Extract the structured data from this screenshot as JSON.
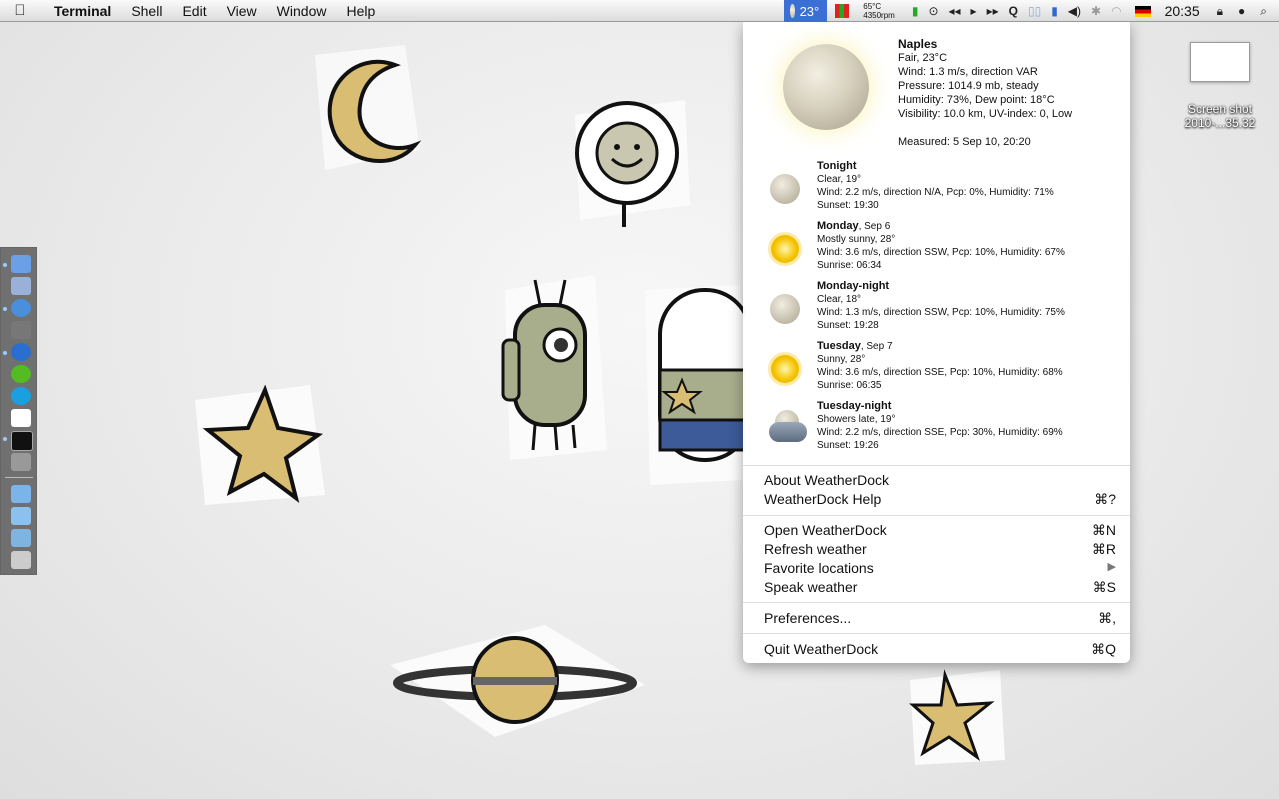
{
  "menubar": {
    "app": "Terminal",
    "menus": [
      "Shell",
      "Edit",
      "View",
      "Window",
      "Help"
    ],
    "weather_temp": "23°",
    "cpu_temp": "65°C",
    "fan": "4350rpm",
    "clock": "20:35"
  },
  "desktop": {
    "icon_label_1": "Screen shot",
    "icon_label_2": "2010-...35.32"
  },
  "current": {
    "city": "Naples",
    "lines": [
      "Fair, 23°C",
      "Wind: 1.3 m/s, direction VAR",
      "Pressure: 1014.9 mb, steady",
      "Humidity: 73%, Dew point: 18°C",
      "Visibility: 10.0 km, UV-index: 0, Low"
    ],
    "measured": "Measured: 5 Sep 10, 20:20"
  },
  "forecast": [
    {
      "day": "Tonight",
      "date": "",
      "cond": "Clear, 19°",
      "wind": "Wind: 2.2 m/s, direction N/A, Pcp: 0%, Humidity: 71%",
      "sun": "Sunset: 19:30",
      "icon": "moon"
    },
    {
      "day": "Monday",
      "date": ", Sep 6",
      "cond": "Mostly sunny, 28°",
      "wind": "Wind: 3.6 m/s, direction SSW, Pcp: 10%, Humidity: 67%",
      "sun": "Sunrise: 06:34",
      "icon": "sun"
    },
    {
      "day": "Monday-night",
      "date": "",
      "cond": "Clear, 18°",
      "wind": "Wind: 1.3 m/s, direction SSW, Pcp: 10%, Humidity: 75%",
      "sun": "Sunset: 19:28",
      "icon": "moon"
    },
    {
      "day": "Tuesday",
      "date": ", Sep 7",
      "cond": "Sunny, 28°",
      "wind": "Wind: 3.6 m/s, direction SSE, Pcp: 10%, Humidity: 68%",
      "sun": "Sunrise: 06:35",
      "icon": "sun"
    },
    {
      "day": "Tuesday-night",
      "date": "",
      "cond": "Showers late, 19°",
      "wind": "Wind: 2.2 m/s, direction SSE, Pcp: 30%, Humidity: 69%",
      "sun": "Sunset: 19:26",
      "icon": "rain"
    }
  ],
  "menu": {
    "about": "About WeatherDock",
    "help": "WeatherDock Help",
    "help_sc": "⌘?",
    "open": "Open WeatherDock",
    "open_sc": "⌘N",
    "refresh": "Refresh weather",
    "refresh_sc": "⌘R",
    "favorites": "Favorite locations",
    "favorites_sc": "▶",
    "speak": "Speak weather",
    "speak_sc": "⌘S",
    "prefs": "Preferences...",
    "prefs_sc": "⌘,",
    "quit": "Quit WeatherDock",
    "quit_sc": "⌘Q"
  }
}
